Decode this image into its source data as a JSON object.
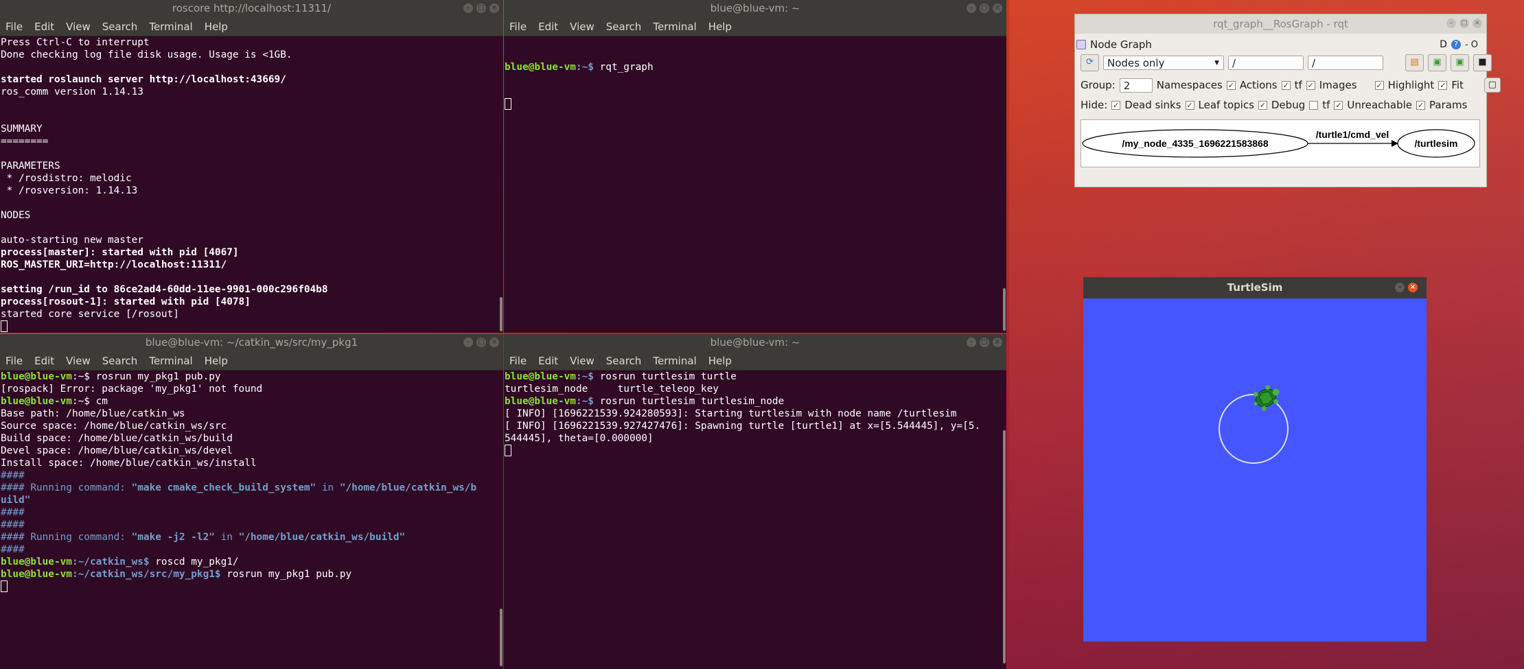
{
  "term_menu": [
    "File",
    "Edit",
    "View",
    "Search",
    "Terminal",
    "Help"
  ],
  "t1": {
    "title": "roscore http://localhost:11311/",
    "lines": [
      {
        "t": "Press Ctrl-C to interrupt",
        "s": ""
      },
      {
        "t": "Done checking log file disk usage. Usage is <1GB.",
        "s": ""
      },
      {
        "t": "",
        "s": ""
      },
      {
        "t": "started roslaunch server http://localhost:43669/",
        "s": "b"
      },
      {
        "t": "ros_comm version 1.14.13",
        "s": ""
      },
      {
        "t": "",
        "s": ""
      },
      {
        "t": "",
        "s": ""
      },
      {
        "t": "SUMMARY",
        "s": ""
      },
      {
        "t": "========",
        "s": ""
      },
      {
        "t": "",
        "s": ""
      },
      {
        "t": "PARAMETERS",
        "s": ""
      },
      {
        "t": " * /rosdistro: melodic",
        "s": ""
      },
      {
        "t": " * /rosversion: 1.14.13",
        "s": ""
      },
      {
        "t": "",
        "s": ""
      },
      {
        "t": "NODES",
        "s": ""
      },
      {
        "t": "",
        "s": ""
      },
      {
        "t": "auto-starting new master",
        "s": ""
      },
      {
        "t": "process[master]: started with pid [4067]",
        "s": "b"
      },
      {
        "t": "ROS_MASTER_URI=http://localhost:11311/",
        "s": "b"
      },
      {
        "t": "",
        "s": ""
      },
      {
        "t": "setting /run_id to 86ce2ad4-60dd-11ee-9901-000c296f04b8",
        "s": "b"
      },
      {
        "t": "process[rosout-1]: started with pid [4078]",
        "s": "b"
      },
      {
        "t": "started core service [/rosout]",
        "s": ""
      }
    ]
  },
  "t2": {
    "title": "blue@blue-vm: ~",
    "prompt_user": "blue@blue-vm",
    "prompt_path": ":~$",
    "command": " rqt_graph"
  },
  "t3": {
    "title": "blue@blue-vm: ~/catkin_ws/src/my_pkg1",
    "lines": [
      [
        {
          "t": "blue@blue-vm",
          "c": "green"
        },
        {
          "t": ":~$",
          "c": ""
        },
        {
          "t": " rosrun my_pkg1 pub.py",
          "c": ""
        }
      ],
      [
        {
          "t": "[rospack] Error: package 'my_pkg1' not found",
          "c": ""
        }
      ],
      [
        {
          "t": "blue@blue-vm",
          "c": "green"
        },
        {
          "t": ":~$",
          "c": ""
        },
        {
          "t": " cm",
          "c": ""
        }
      ],
      [
        {
          "t": "Base path: /home/blue/catkin_ws",
          "c": ""
        }
      ],
      [
        {
          "t": "Source space: /home/blue/catkin_ws/src",
          "c": ""
        }
      ],
      [
        {
          "t": "Build space: /home/blue/catkin_ws/build",
          "c": ""
        }
      ],
      [
        {
          "t": "Devel space: /home/blue/catkin_ws/devel",
          "c": ""
        }
      ],
      [
        {
          "t": "Install space: /home/blue/catkin_ws/install",
          "c": ""
        }
      ],
      [
        {
          "t": "####",
          "c": "bluel"
        }
      ],
      [
        {
          "t": "#### Running command: ",
          "c": "bluel"
        },
        {
          "t": "\"make cmake_check_build_system\"",
          "c": "blue"
        },
        {
          "t": " in ",
          "c": "bluel"
        },
        {
          "t": "\"/home/blue/catkin_ws/b",
          "c": "blue"
        }
      ],
      [
        {
          "t": "uild\"",
          "c": "blue"
        }
      ],
      [
        {
          "t": "####",
          "c": "bluel"
        }
      ],
      [
        {
          "t": "####",
          "c": "bluel"
        }
      ],
      [
        {
          "t": "#### Running command: ",
          "c": "bluel"
        },
        {
          "t": "\"make -j2 -l2\"",
          "c": "blue"
        },
        {
          "t": " in ",
          "c": "bluel"
        },
        {
          "t": "\"/home/blue/catkin_ws/build\"",
          "c": "blue"
        }
      ],
      [
        {
          "t": "####",
          "c": "bluel"
        }
      ],
      [
        {
          "t": "blue@blue-vm",
          "c": "green"
        },
        {
          "t": ":~/catkin_ws$",
          "c": "blue"
        },
        {
          "t": " roscd my_pkg1/",
          "c": ""
        }
      ],
      [
        {
          "t": "blue@blue-vm",
          "c": "green"
        },
        {
          "t": ":~/catkin_ws/src/my_pkg1$",
          "c": "blue"
        },
        {
          "t": " rosrun my_pkg1 pub.py",
          "c": ""
        }
      ]
    ]
  },
  "t4": {
    "title": "blue@blue-vm: ~",
    "lines": [
      [
        {
          "t": "blue@blue-vm",
          "c": "green"
        },
        {
          "t": ":~$",
          "c": "blue"
        },
        {
          "t": " rosrun turtlesim turtle",
          "c": ""
        }
      ],
      [
        {
          "t": "turtlesim_node     turtle_teleop_key",
          "c": ""
        }
      ],
      [
        {
          "t": "blue@blue-vm",
          "c": "green"
        },
        {
          "t": ":~$",
          "c": "blue"
        },
        {
          "t": " rosrun turtlesim turtlesim_node",
          "c": ""
        }
      ],
      [
        {
          "t": "[ INFO] [1696221539.924280593]: Starting turtlesim with node name /turtlesim",
          "c": ""
        }
      ],
      [
        {
          "t": "[ INFO] [1696221539.927427476]: Spawning turtle [turtle1] at x=[5.544445], y=[5.",
          "c": ""
        }
      ],
      [
        {
          "t": "544445], theta=[0.000000]",
          "c": ""
        }
      ]
    ]
  },
  "rqt": {
    "title": "rqt_graph__RosGraph - rqt",
    "plugin_title": "Node Graph",
    "plugin_buttons": "D",
    "plugin_extra": "- O",
    "mode": "Nodes only",
    "filter1": "/",
    "filter2": "/",
    "group_label": "Group:",
    "group_value": "2",
    "opts": {
      "namespaces": "Namespaces",
      "actions": "Actions",
      "tf": "tf",
      "images": "Images",
      "highlight": "Highlight",
      "fit": "Fit"
    },
    "hide_label": "Hide:",
    "hide": {
      "dead_sinks": "Dead sinks",
      "leaf_topics": "Leaf topics",
      "debug": "Debug",
      "tf": "tf",
      "unreachable": "Unreachable",
      "params": "Params"
    },
    "graph": {
      "node_a": "/my_node_4335_1696221583868",
      "edge": "/turtle1/cmd_vel",
      "node_b": "/turtlesim"
    }
  },
  "turtlesim": {
    "title": "TurtleSim",
    "bg_color": "#4556ff"
  }
}
